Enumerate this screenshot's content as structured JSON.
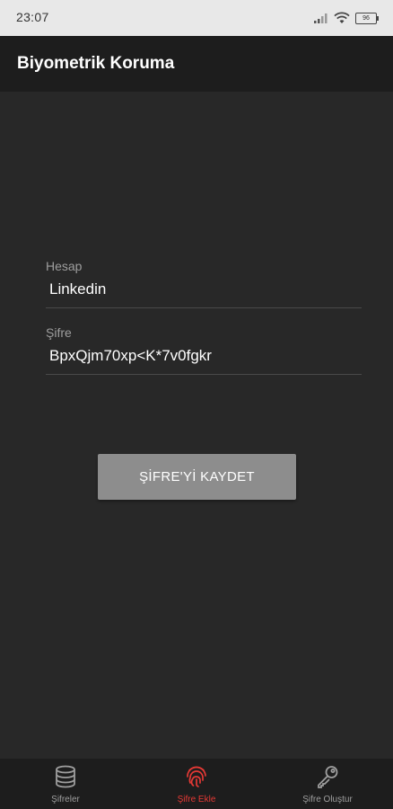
{
  "status_bar": {
    "time": "23:07",
    "battery": "96"
  },
  "app_bar": {
    "title": "Biyometrik Koruma"
  },
  "form": {
    "account_label": "Hesap",
    "account_value": "Linkedin",
    "password_label": "Şifre",
    "password_value": "BpxQjm70xp<K*7v0fgkr",
    "save_label": "ŞİFRE'Yİ KAYDET"
  },
  "bottom_nav": {
    "items": [
      {
        "label": "Şifreler",
        "icon": "database-icon",
        "active": false
      },
      {
        "label": "Şifre Ekle",
        "icon": "fingerprint-icon",
        "active": true
      },
      {
        "label": "Şifre Oluştur",
        "icon": "key-icon",
        "active": false
      }
    ]
  },
  "colors": {
    "background": "#282828",
    "app_bar": "#1d1d1d",
    "accent": "#e53935",
    "button": "#8d8d8d"
  }
}
